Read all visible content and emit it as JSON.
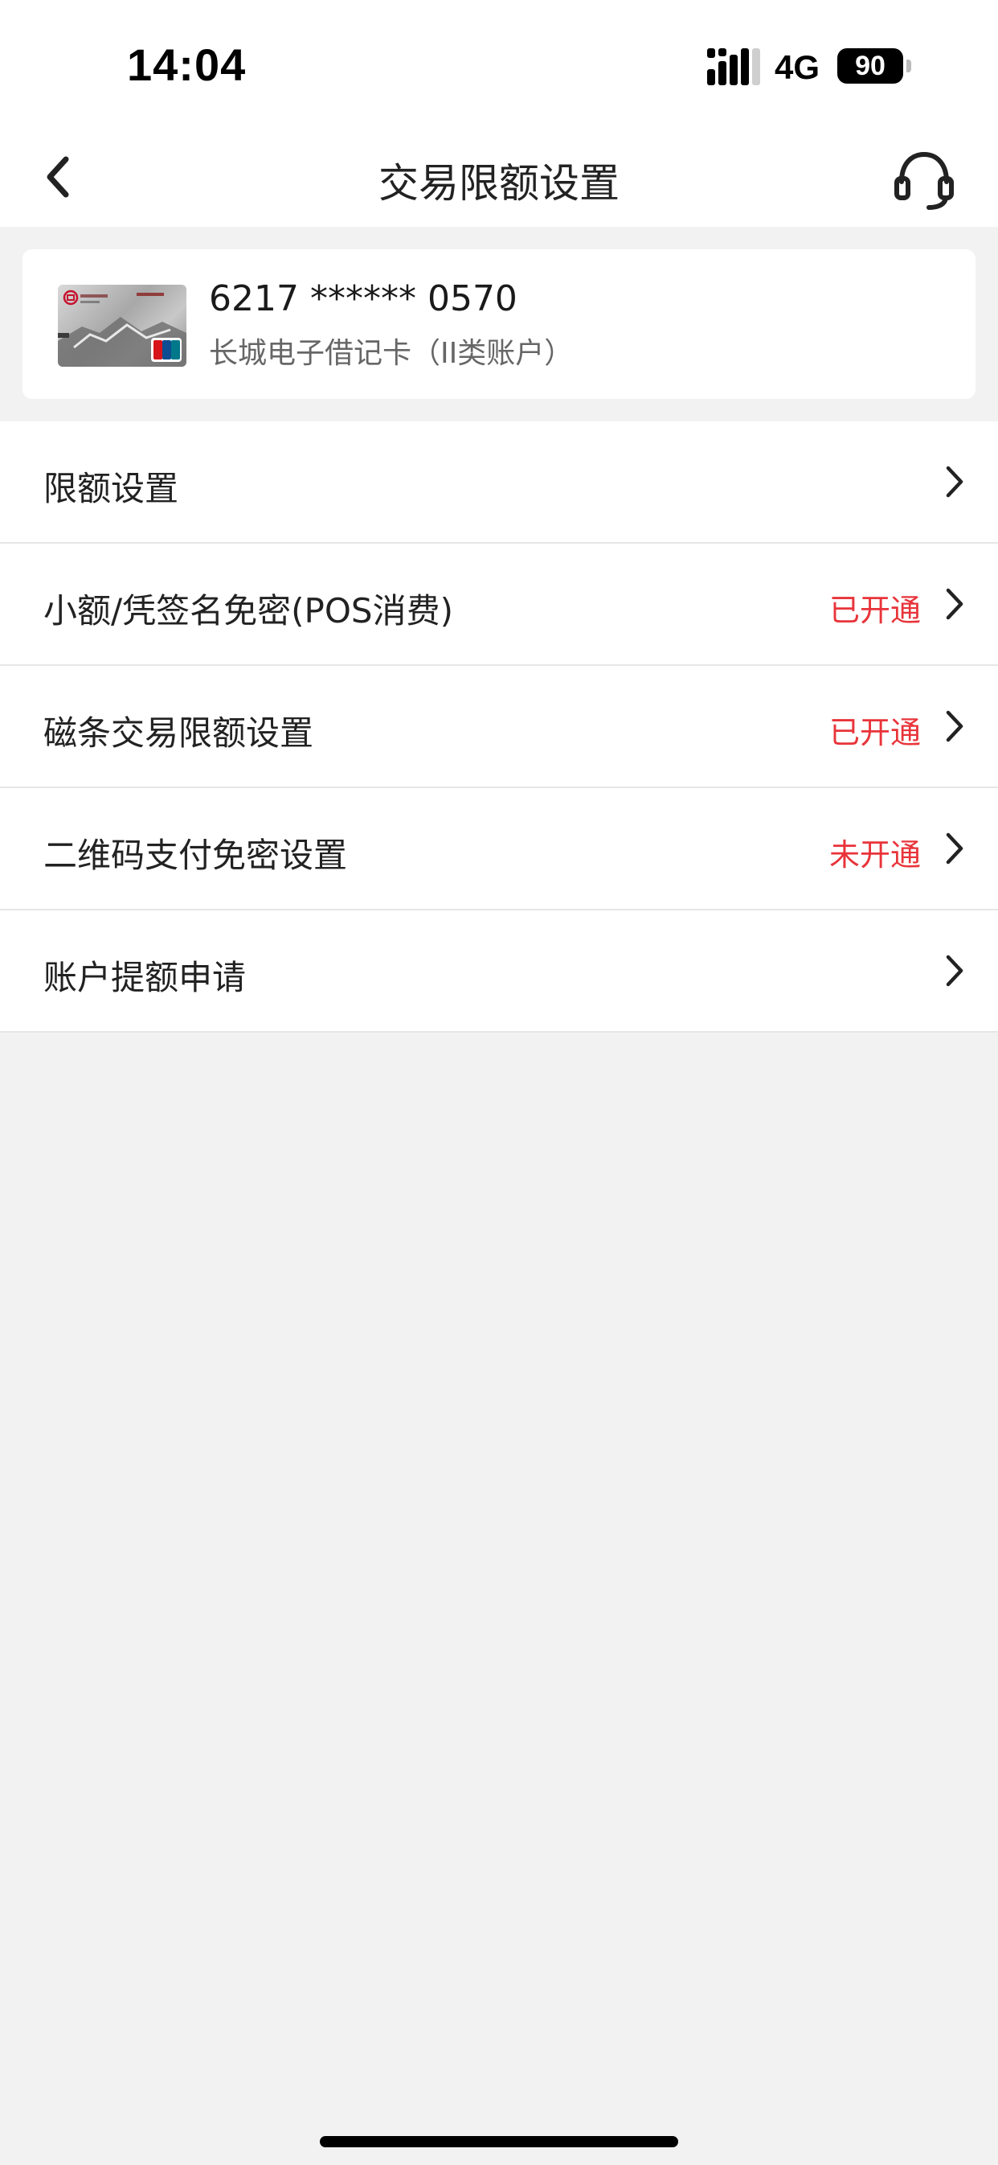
{
  "status_bar": {
    "time": "14:04",
    "network": "4G",
    "battery": "90"
  },
  "header": {
    "title": "交易限额设置",
    "back_icon": "chevron-left-icon",
    "service_icon": "headset-icon"
  },
  "card": {
    "number": "6217 ****** 0570",
    "type": "长城电子借记卡（II类账户）"
  },
  "menu": [
    {
      "label": "限额设置",
      "status": ""
    },
    {
      "label": "小额/凭签名免密(POS消费)",
      "status": "已开通"
    },
    {
      "label": "磁条交易限额设置",
      "status": "已开通"
    },
    {
      "label": "二维码支付免密设置",
      "status": "未开通"
    },
    {
      "label": "账户提额申请",
      "status": ""
    }
  ],
  "colors": {
    "accent_status": "#e8343a",
    "background": "#f2f2f2",
    "text": "#222222"
  }
}
